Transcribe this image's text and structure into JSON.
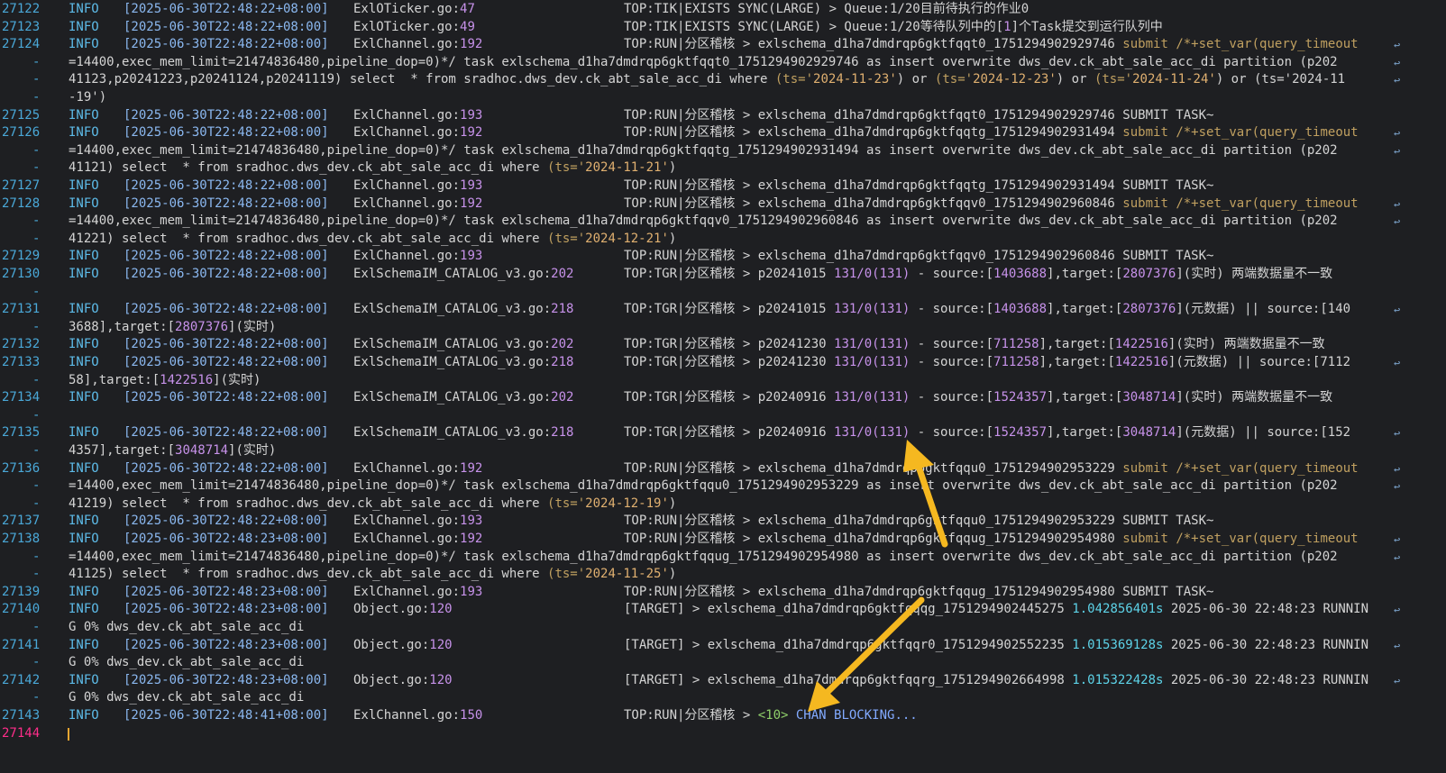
{
  "terminal": {
    "lines": [
      {
        "ln": "27122",
        "lvl": "INFO",
        "ts": "[2025-06-30T22:48:22+08:00]",
        "src": "ExlOTicker.go:47",
        "msg": "TOP:TIK|EXISTS SYNC(LARGE) > Queue:1/20目前待执行的作业0"
      },
      {
        "ln": "27123",
        "lvl": "INFO",
        "ts": "[2025-06-30T22:48:22+08:00]",
        "src": "ExlOTicker.go:49",
        "msg": "TOP:TIK|EXISTS SYNC(LARGE) > Queue:1/20等待队列中的[1]个Task提交到运行队列中"
      },
      {
        "ln": "27124",
        "lvl": "INFO",
        "ts": "[2025-06-30T22:48:22+08:00]",
        "src": "ExlChannel.go:192",
        "msg": "TOP:RUN|分区稽核 > exlschema_d1ha7dmdrqp6gktfqqt0_1751294902929746 submit /*+set_var(query_timeout"
      },
      {
        "wrap": "=14400,exec_mem_limit=21474836480,pipeline_dop=0)*/ task exlschema_d1ha7dmdrqp6gktfqqt0_1751294902929746 as insert overwrite dws_dev.ck_abt_sale_acc_di partition (p202"
      },
      {
        "wrap": "41123,p20241223,p20241124,p20241119) select  * from sradhoc.dws_dev.ck_abt_sale_acc_di where (ts='2024-11-23') or (ts='2024-12-23') or (ts='2024-11-24') or (ts='2024-11"
      },
      {
        "wrap": "-19')"
      },
      {
        "ln": "27125",
        "lvl": "INFO",
        "ts": "[2025-06-30T22:48:22+08:00]",
        "src": "ExlChannel.go:193",
        "msg": "TOP:RUN|分区稽核 > exlschema_d1ha7dmdrqp6gktfqqt0_1751294902929746 SUBMIT TASK~"
      },
      {
        "ln": "27126",
        "lvl": "INFO",
        "ts": "[2025-06-30T22:48:22+08:00]",
        "src": "ExlChannel.go:192",
        "msg": "TOP:RUN|分区稽核 > exlschema_d1ha7dmdrqp6gktfqqtg_1751294902931494 submit /*+set_var(query_timeout"
      },
      {
        "wrap": "=14400,exec_mem_limit=21474836480,pipeline_dop=0)*/ task exlschema_d1ha7dmdrqp6gktfqqtg_1751294902931494 as insert overwrite dws_dev.ck_abt_sale_acc_di partition (p202"
      },
      {
        "wrap": "41121) select  * from sradhoc.dws_dev.ck_abt_sale_acc_di where (ts='2024-11-21')"
      },
      {
        "ln": "27127",
        "lvl": "INFO",
        "ts": "[2025-06-30T22:48:22+08:00]",
        "src": "ExlChannel.go:193",
        "msg": "TOP:RUN|分区稽核 > exlschema_d1ha7dmdrqp6gktfqqtg_1751294902931494 SUBMIT TASK~"
      },
      {
        "ln": "27128",
        "lvl": "INFO",
        "ts": "[2025-06-30T22:48:22+08:00]",
        "src": "ExlChannel.go:192",
        "msg": "TOP:RUN|分区稽核 > exlschema_d1ha7dmdrqp6gktfqqv0_1751294902960846 submit /*+set_var(query_timeout"
      },
      {
        "wrap": "=14400,exec_mem_limit=21474836480,pipeline_dop=0)*/ task exlschema_d1ha7dmdrqp6gktfqqv0_1751294902960846 as insert overwrite dws_dev.ck_abt_sale_acc_di partition (p202"
      },
      {
        "wrap": "41221) select  * from sradhoc.dws_dev.ck_abt_sale_acc_di where (ts='2024-12-21')"
      },
      {
        "ln": "27129",
        "lvl": "INFO",
        "ts": "[2025-06-30T22:48:22+08:00]",
        "src": "ExlChannel.go:193",
        "msg": "TOP:RUN|分区稽核 > exlschema_d1ha7dmdrqp6gktfqqv0_1751294902960846 SUBMIT TASK~"
      },
      {
        "ln": "27130",
        "lvl": "INFO",
        "ts": "[2025-06-30T22:48:22+08:00]",
        "src": "ExlSchemaIM_CATALOG_v3.go:202",
        "msg": "TOP:TGR|分区稽核 > p20241015 131/0(131) - source:[1403688],target:[2807376](实时) 两端数据量不一致"
      },
      {
        "wrap": ""
      },
      {
        "ln": "27131",
        "lvl": "INFO",
        "ts": "[2025-06-30T22:48:22+08:00]",
        "src": "ExlSchemaIM_CATALOG_v3.go:218",
        "msg": "TOP:TGR|分区稽核 > p20241015 131/0(131) - source:[1403688],target:[2807376](元数据) || source:[140"
      },
      {
        "wrap": "3688],target:[2807376](实时)"
      },
      {
        "ln": "27132",
        "lvl": "INFO",
        "ts": "[2025-06-30T22:48:22+08:00]",
        "src": "ExlSchemaIM_CATALOG_v3.go:202",
        "msg": "TOP:TGR|分区稽核 > p20241230 131/0(131) - source:[711258],target:[1422516](实时) 两端数据量不一致"
      },
      {
        "ln": "27133",
        "lvl": "INFO",
        "ts": "[2025-06-30T22:48:22+08:00]",
        "src": "ExlSchemaIM_CATALOG_v3.go:218",
        "msg": "TOP:TGR|分区稽核 > p20241230 131/0(131) - source:[711258],target:[1422516](元数据) || source:[7112"
      },
      {
        "wrap": "58],target:[1422516](实时)"
      },
      {
        "ln": "27134",
        "lvl": "INFO",
        "ts": "[2025-06-30T22:48:22+08:00]",
        "src": "ExlSchemaIM_CATALOG_v3.go:202",
        "msg": "TOP:TGR|分区稽核 > p20240916 131/0(131) - source:[1524357],target:[3048714](实时) 两端数据量不一致"
      },
      {
        "wrap": ""
      },
      {
        "ln": "27135",
        "lvl": "INFO",
        "ts": "[2025-06-30T22:48:22+08:00]",
        "src": "ExlSchemaIM_CATALOG_v3.go:218",
        "msg": "TOP:TGR|分区稽核 > p20240916 131/0(131) - source:[1524357],target:[3048714](元数据) || source:[152"
      },
      {
        "wrap": "4357],target:[3048714](实时)"
      },
      {
        "ln": "27136",
        "lvl": "INFO",
        "ts": "[2025-06-30T22:48:22+08:00]",
        "src": "ExlChannel.go:192",
        "msg": "TOP:RUN|分区稽核 > exlschema_d1ha7dmdrqp6gktfqqu0_1751294902953229 submit /*+set_var(query_timeout"
      },
      {
        "wrap": "=14400,exec_mem_limit=21474836480,pipeline_dop=0)*/ task exlschema_d1ha7dmdrqp6gktfqqu0_1751294902953229 as insert overwrite dws_dev.ck_abt_sale_acc_di partition (p202"
      },
      {
        "wrap": "41219) select  * from sradhoc.dws_dev.ck_abt_sale_acc_di where (ts='2024-12-19')"
      },
      {
        "ln": "27137",
        "lvl": "INFO",
        "ts": "[2025-06-30T22:48:22+08:00]",
        "src": "ExlChannel.go:193",
        "msg": "TOP:RUN|分区稽核 > exlschema_d1ha7dmdrqp6gktfqqu0_1751294902953229 SUBMIT TASK~"
      },
      {
        "ln": "27138",
        "lvl": "INFO",
        "ts": "[2025-06-30T22:48:23+08:00]",
        "src": "ExlChannel.go:192",
        "msg": "TOP:RUN|分区稽核 > exlschema_d1ha7dmdrqp6gktfqqug_1751294902954980 submit /*+set_var(query_timeout"
      },
      {
        "wrap": "=14400,exec_mem_limit=21474836480,pipeline_dop=0)*/ task exlschema_d1ha7dmdrqp6gktfqqug_1751294902954980 as insert overwrite dws_dev.ck_abt_sale_acc_di partition (p202"
      },
      {
        "wrap": "41125) select  * from sradhoc.dws_dev.ck_abt_sale_acc_di where (ts='2024-11-25')"
      },
      {
        "ln": "27139",
        "lvl": "INFO",
        "ts": "[2025-06-30T22:48:23+08:00]",
        "src": "ExlChannel.go:193",
        "msg": "TOP:RUN|分区稽核 > exlschema_d1ha7dmdrqp6gktfqqug_1751294902954980 SUBMIT TASK~"
      },
      {
        "ln": "27140",
        "lvl": "INFO",
        "ts": "[2025-06-30T22:48:23+08:00]",
        "src": "Object.go:120",
        "msg": "[TARGET] > exlschema_d1ha7dmdrqp6gktfqqqg_1751294902445275 1.042856401s 2025-06-30 22:48:23 RUNNIN"
      },
      {
        "wrap": "G 0% dws_dev.ck_abt_sale_acc_di"
      },
      {
        "ln": "27141",
        "lvl": "INFO",
        "ts": "[2025-06-30T22:48:23+08:00]",
        "src": "Object.go:120",
        "msg": "[TARGET] > exlschema_d1ha7dmdrqp6gktfqqr0_1751294902552235 1.015369128s 2025-06-30 22:48:23 RUNNIN"
      },
      {
        "wrap": "G 0% dws_dev.ck_abt_sale_acc_di"
      },
      {
        "ln": "27142",
        "lvl": "INFO",
        "ts": "[2025-06-30T22:48:23+08:00]",
        "src": "Object.go:120",
        "msg": "[TARGET] > exlschema_d1ha7dmdrqp6gktfqqrg_1751294902664998 1.015322428s 2025-06-30 22:48:23 RUNNIN"
      },
      {
        "wrap": "G 0% dws_dev.ck_abt_sale_acc_di"
      },
      {
        "ln": "27143",
        "lvl": "INFO",
        "ts": "[2025-06-30T22:48:41+08:00]",
        "src": "ExlChannel.go:150",
        "msg": "TOP:RUN|分区稽核 > <10> CHAN BLOCKING..."
      },
      {
        "ln": "27144",
        "current": true
      }
    ],
    "wrap_marker": "-",
    "colors": {
      "background": "#1e1f22",
      "line_number": "#4aa8d8",
      "current_line_number": "#ff2d8a",
      "cursor": "#e8a531",
      "annotation_arrow": "#f5b820"
    }
  },
  "annotations": {
    "arrow_icons": [
      "arrow-up-icon",
      "arrow-down-left-icon"
    ]
  }
}
